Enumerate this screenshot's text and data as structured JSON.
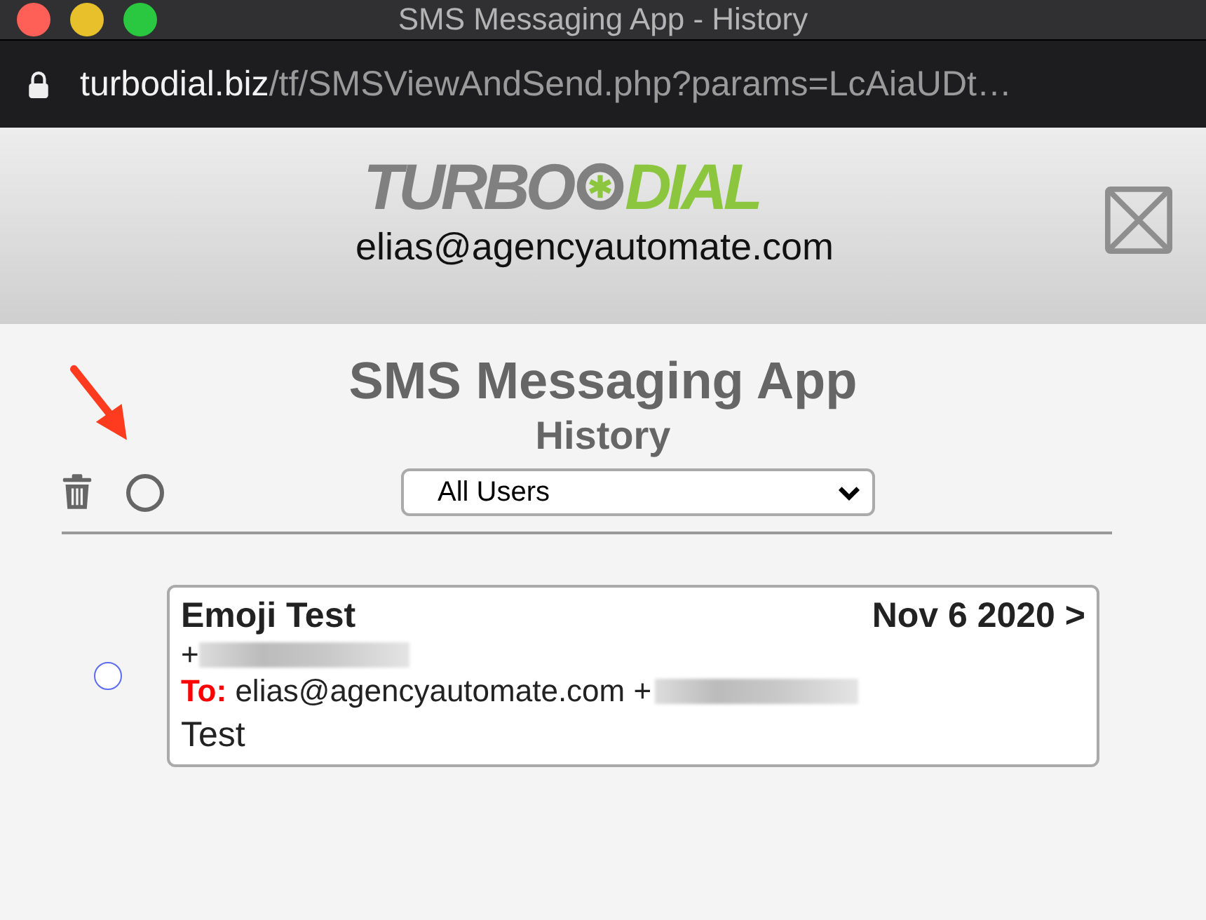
{
  "window": {
    "title": "SMS Messaging App - History"
  },
  "address_bar": {
    "domain": "turbodial.biz",
    "path": "/tf/SMSViewAndSend.php?params=LcAiaUDt…"
  },
  "header": {
    "logo": [
      {
        "text": "TURBO",
        "color": "#808080"
      },
      {
        "text": "DIAL",
        "color": "#8cc63f"
      }
    ],
    "account": "elias@agencyautomate.com"
  },
  "page": {
    "title": "SMS Messaging App",
    "subtitle": "History"
  },
  "toolbar": {
    "select_all": {
      "selected": false
    },
    "user_filter": {
      "value": "All Users"
    }
  },
  "messages": [
    {
      "selected": false,
      "subject": "Emoji Test",
      "date": "Nov 6 2020 >",
      "from_prefix": "+",
      "to_label": "To:",
      "to": "elias@agencyautomate.com +",
      "body": "Test"
    }
  ]
}
